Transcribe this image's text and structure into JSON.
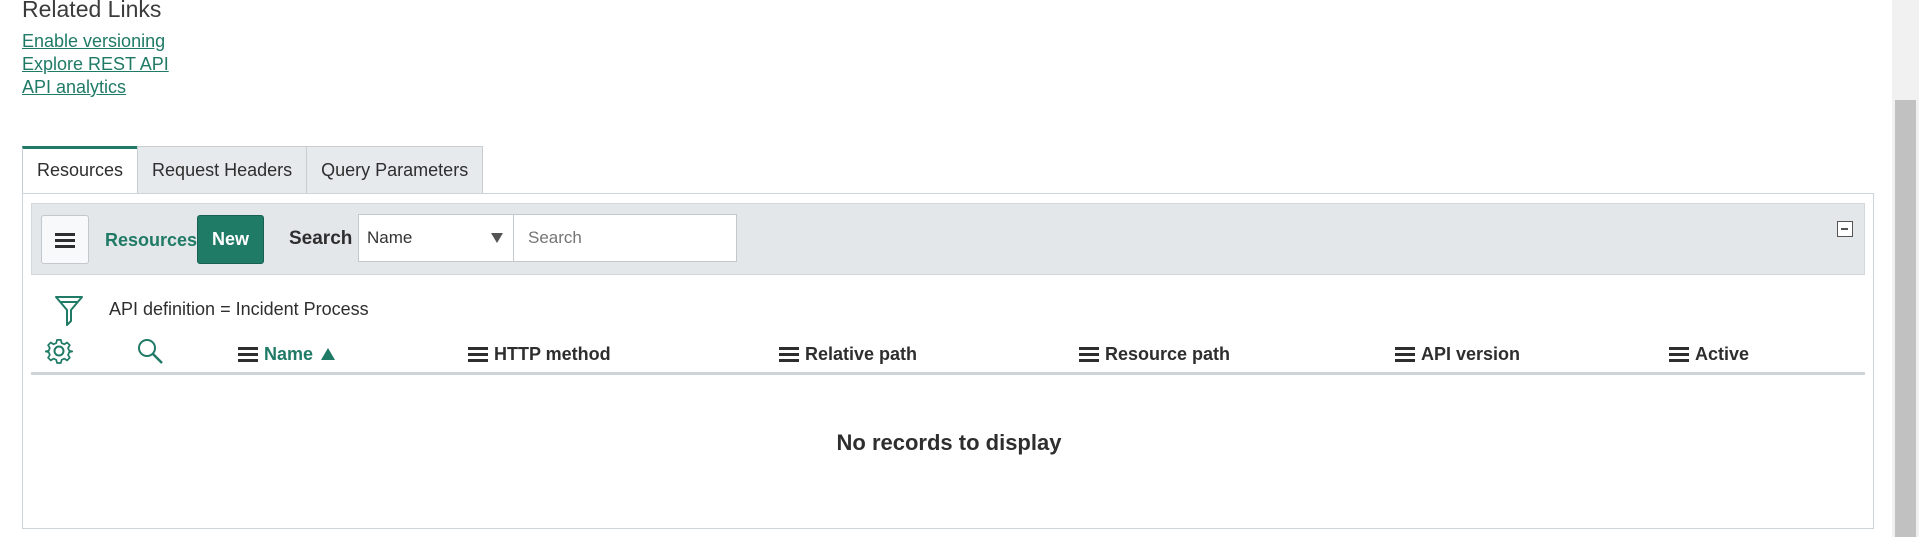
{
  "related_links": {
    "title": "Related Links",
    "links": [
      "Enable versioning",
      "Explore REST API",
      "API analytics"
    ]
  },
  "tabs": [
    "Resources",
    "Request Headers",
    "Query Parameters"
  ],
  "active_tab": "Resources",
  "toolbar": {
    "list_label": "Resources",
    "new_label": "New",
    "search_label": "Search",
    "search_field_selected": "Name",
    "search_placeholder": "Search"
  },
  "filter": {
    "text": "API definition = Incident Process"
  },
  "columns": [
    "Name",
    "HTTP method",
    "Relative path",
    "Resource path",
    "API version",
    "Active"
  ],
  "sorted_column": "Name",
  "sort_direction": "ascending",
  "empty_message": "No records to display",
  "colors": {
    "accent": "#1f7a66",
    "toolbar_bg": "#e4e7ea",
    "tab_bg": "#e6eaed"
  },
  "icons": [
    "list-menu-icon",
    "collapse-icon",
    "filter-funnel-icon",
    "gear-icon",
    "search-magnifier-icon",
    "column-menu-icon",
    "sort-ascending-icon"
  ]
}
